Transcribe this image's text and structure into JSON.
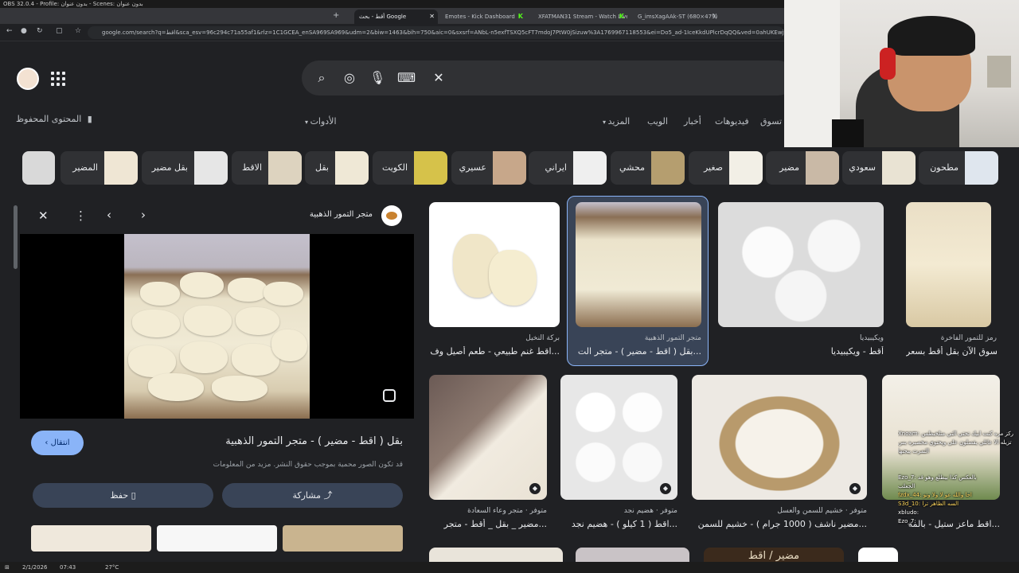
{
  "obs": {
    "title": "OBS 32.0.4 - Profile: بدون عنوان - Scenes: بدون عنوان"
  },
  "tabs": [
    {
      "label": "أقط - بحث Google",
      "active": true
    },
    {
      "label": "Emotes - Kick Dashboard"
    },
    {
      "label": "XFATMAN31 Stream - Watch Live"
    },
    {
      "label": "G_imsXagAAk-ST (680×479)"
    }
  ],
  "url": "google.com/search?q=اقط&sca_esv=96c294c71a55af1&rlz=1C1GCEA_enSA969SA969&udm=2&biw=1463&bih=750&aic=0&sxsrf=ANbL-n5exfTSXQ5cFT7mdoJ7PtW0jSizuw%3A1769967118553&ei=Do5_ad-1IceKkdUPlcrDqQQ&ved=0ahUKEwjf9PWq6biSAxVHRaQEHRXIMEQ",
  "nav": {
    "saved": "المحتوى المحفوظ",
    "tabs": [
      "تسوق",
      "فيديوهات",
      "أخبار",
      "الويب",
      "المزيد",
      "الأدوات"
    ]
  },
  "chips": [
    "مطحون",
    "سعودي",
    "مضير",
    "صغير",
    "محشي",
    "ايراني",
    "عسيري",
    "الكويت",
    "بقل",
    "الاقط",
    "بقل مضير",
    "المضير"
  ],
  "panel": {
    "site": "متجر التمور الذهبية",
    "title": "بقل ( اقط - مضير ) - متجر التمور الذهبية",
    "copyright": "قد تكون الصور محمية بموجب حقوق النشر. مزيد من المعلومات",
    "visit": "انتقال",
    "share": "مشاركة",
    "save": "حفظ"
  },
  "results": [
    {
      "source": "بركة النخيل",
      "title": "اقط غنم طبيعي - طعم أصيل وف..."
    },
    {
      "source": "متجر التمور الذهبية",
      "title": "بقل ( اقط - مضير ) - متجر الت..."
    },
    {
      "source": "ويكيبيديا",
      "title": "أقط - ويكيبيديا"
    },
    {
      "source": "رمز للتمور الفاخرة",
      "title": "تسوق الآن بقل أقط بسعر..."
    },
    {
      "source": "متوفر · متجر وعاء السعادة",
      "title": "مضير _ بقل _ أقط - متجر..."
    },
    {
      "source": "متوفر · هضيم نجد",
      "title": "اقط ( 1 كيلو ) - هضيم نجد..."
    },
    {
      "source": "متوفر · خشيم للسمن والعسل",
      "title": "مضير ناشف ( 1000 جرام ) - خشيم للسمن..."
    },
    {
      "source": "",
      "title": "اقط ماعز ستيل - بالمة..."
    }
  ],
  "bottom_banner": "مضير / اقط",
  "chat": [
    "Xnoam: ركز مره كنت ابيك تحتي التي متلخبطمن",
    "تزيله الا عائلي يقصلون على ويحتوي مخصيره بس",
    "التمرت يبجتها",
    "Ezo_7: بالعكس كذا بيطلع وهو قد",
    "الجعلب",
    "fzdx_44: احا والله عو لا ولا ونو",
    "S3d_10: السه الظاهر ترا",
    "xbludo:",
    "Ezo_7:"
  ],
  "taskbar": {
    "temp": "27°C",
    "time": "07:43",
    "date": "2/1/2026"
  }
}
